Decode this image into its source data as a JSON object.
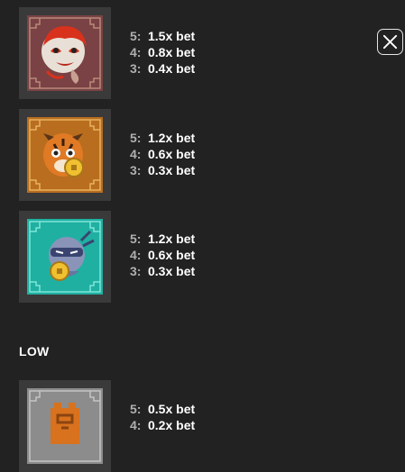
{
  "close": {
    "icon": "close-icon"
  },
  "symbols": [
    {
      "art": "monkey-mask-icon",
      "bg": "#6e3a3a",
      "payouts": [
        {
          "count": "5:",
          "value": "1.5x bet"
        },
        {
          "count": "4:",
          "value": "0.8x bet"
        },
        {
          "count": "3:",
          "value": "0.4x bet"
        }
      ]
    },
    {
      "art": "tiger-coin-icon",
      "bg": "#b06a1a",
      "payouts": [
        {
          "count": "5:",
          "value": "1.2x bet"
        },
        {
          "count": "4:",
          "value": "0.6x bet"
        },
        {
          "count": "3:",
          "value": "0.3x bet"
        }
      ]
    },
    {
      "art": "ninja-coin-icon",
      "bg": "#1aa59a",
      "payouts": [
        {
          "count": "5:",
          "value": "1.2x bet"
        },
        {
          "count": "4:",
          "value": "0.6x bet"
        },
        {
          "count": "3:",
          "value": "0.3x bet"
        }
      ]
    }
  ],
  "low_section": {
    "title": "LOW",
    "symbol": {
      "art": "low-symbol-icon",
      "bg": "#8a8a8a",
      "payouts": [
        {
          "count": "5:",
          "value": "0.5x bet"
        },
        {
          "count": "4:",
          "value": "0.2x bet"
        }
      ]
    }
  }
}
